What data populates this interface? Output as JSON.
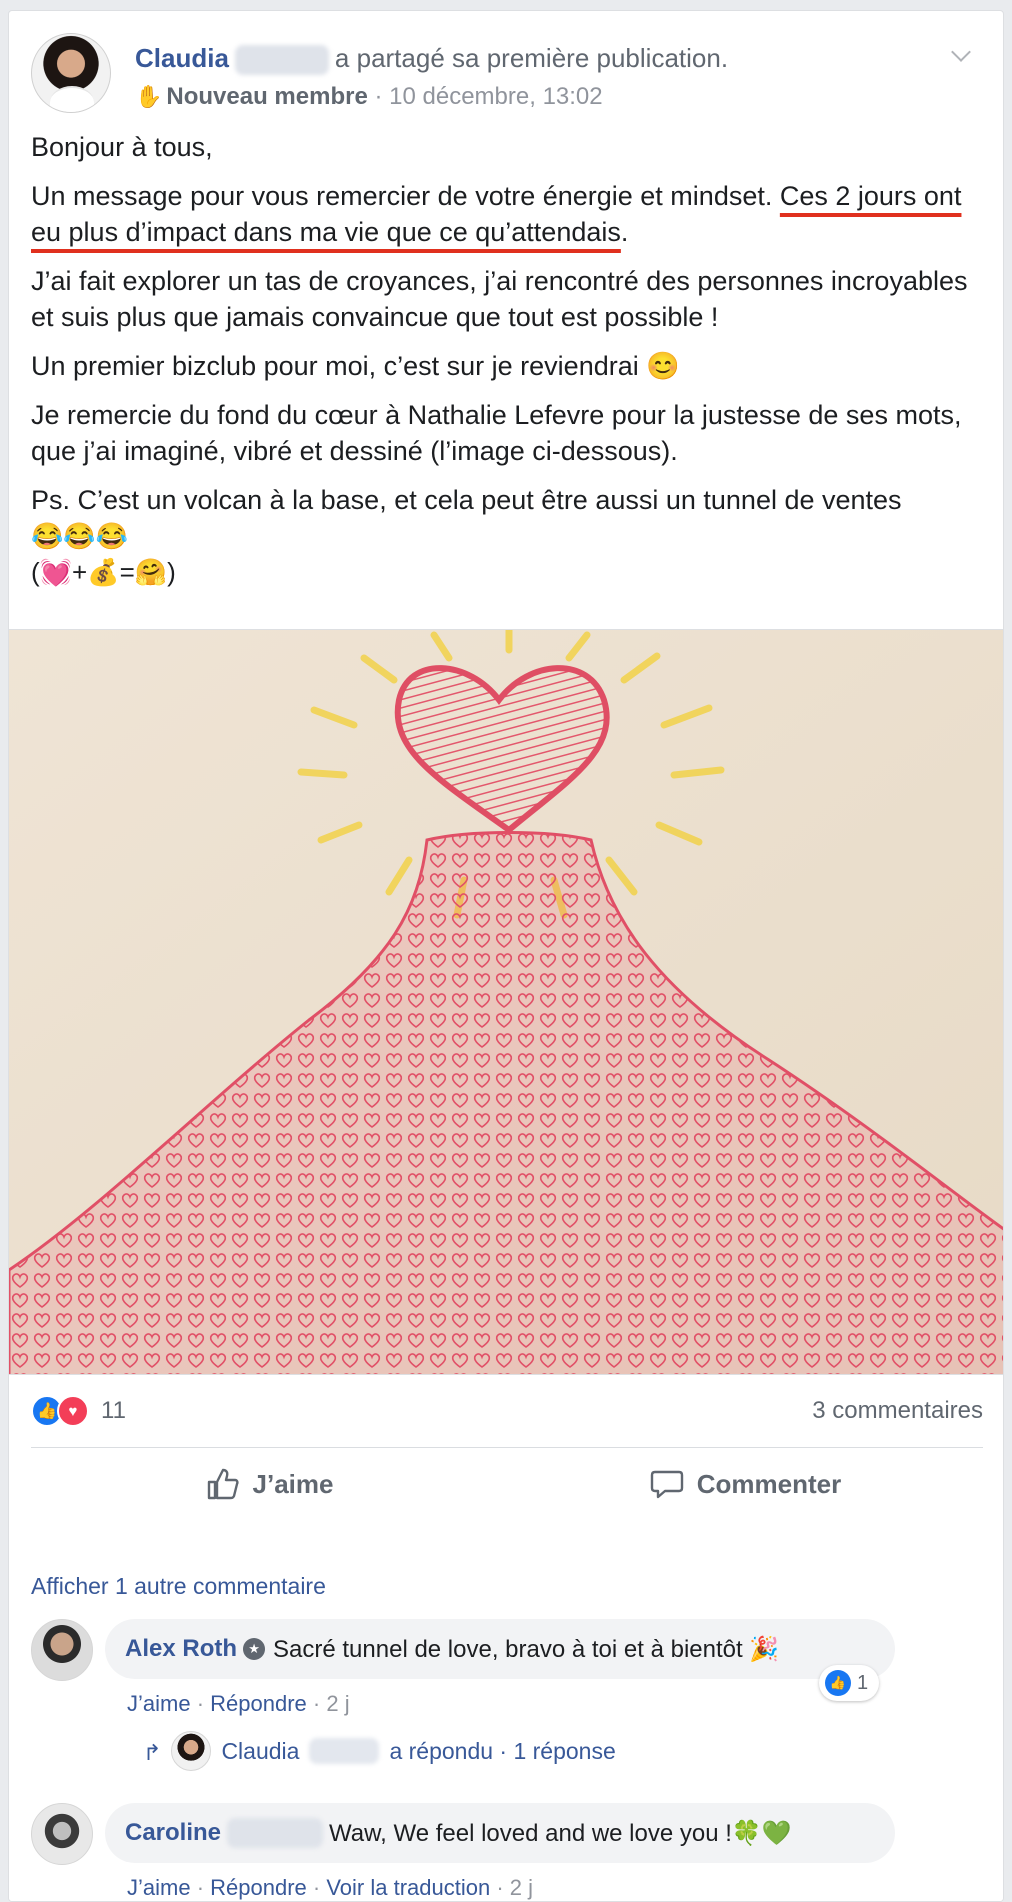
{
  "post": {
    "author": "Claudia",
    "action": "a partagé sa première publication.",
    "badge": "Nouveau membre",
    "timestamp": "· 10 décembre, 13:02",
    "paragraphs": {
      "p1": "Bonjour à tous,",
      "p2_plain": "Un message pour vous remercier de votre énergie et mindset. ",
      "p2_highlight": "Ces 2 jours ont eu plus d’impact dans ma vie que ce qu’attendais",
      "p2_end": ".",
      "p3": "J’ai fait explorer un tas de croyances, j’ai rencontré des personnes incroyables et suis plus que jamais convaincue que tout est possible !",
      "p4": "Un premier bizclub pour moi, c’est sur je reviendrai 😊",
      "p5": "Je remercie du fond du cœur à Nathalie Lefevre pour la justesse de ses mots, que j’ai imaginé, vibré et dessiné (l’image ci-dessous).",
      "p6": "Ps. C’est un volcan à la base, et cela peut être aussi un tunnel de ventes",
      "emoji1": "😂😂😂",
      "emoji2": "(💓+💰=🤗)"
    }
  },
  "reactions": {
    "like_icon": "👍",
    "love_icon": "♥",
    "count": "11",
    "comments": "3 commentaires"
  },
  "actions": {
    "like": "J’aime",
    "comment": "Commenter"
  },
  "comments": {
    "more": "Afficher 1 autre commentaire",
    "items": [
      {
        "name": "Alex Roth",
        "text": "Sacré tunnel de love, bravo à toi et à bientôt 🎉",
        "like_count": "1",
        "like": "J’aime",
        "reply": "Répondre",
        "time": "2 j"
      },
      {
        "name": "Caroline",
        "text": "Waw, We feel loved and we love you !🍀💚",
        "like": "J’aime",
        "reply": "Répondre",
        "translate": "Voir la traduction",
        "time": "2 j"
      }
    ],
    "reply_summary": {
      "name": "Claudia",
      "text": "a répondu · 1 réponse"
    }
  },
  "colors": {
    "link": "#385898",
    "muted": "#606770",
    "like": "#1877f2",
    "love": "#f33e58",
    "underline": "#e0301e",
    "drawing": "#e5576b"
  }
}
